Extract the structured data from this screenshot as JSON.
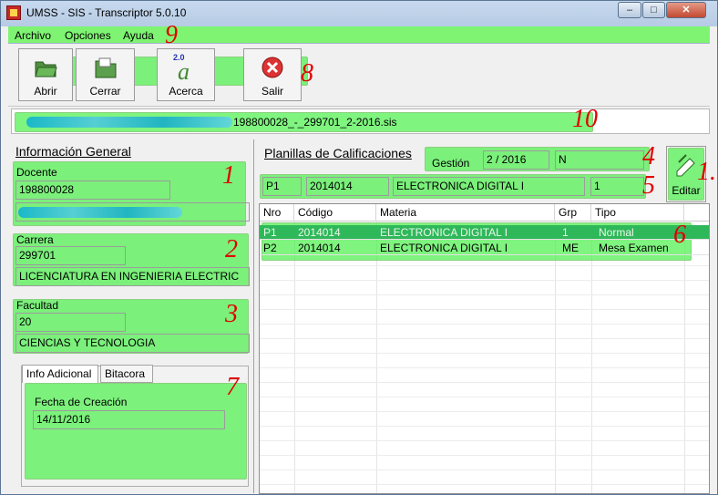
{
  "window": {
    "title": "UMSS - SIS - Transcriptor 5.0.10",
    "buttons": [
      "‒",
      "□",
      "✕"
    ]
  },
  "menu": [
    "Archivo",
    "Opciones",
    "Ayuda"
  ],
  "toolbar": {
    "open": "Abrir",
    "close": "Cerrar",
    "about": "Acerca",
    "exit": "Salir",
    "about_badge": "2.0"
  },
  "file": {
    "name": "198800028_-_299701_2-2016.sis"
  },
  "info": {
    "title": "Información General",
    "docente_label": "Docente",
    "docente_code": "198800028",
    "carrera_label": "Carrera",
    "carrera_code": "299701",
    "carrera_name": "LICENCIATURA EN INGENIERIA ELECTRIC",
    "facultad_label": "Facultad",
    "facultad_code": "20",
    "facultad_name": "CIENCIAS Y TECNOLOGIA"
  },
  "tabs": {
    "info": "Info Adicional",
    "bitacora": "Bitacora",
    "fecha_label": "Fecha de Creación",
    "fecha_value": "14/11/2016"
  },
  "planillas": {
    "title": "Planillas de Calificaciones",
    "gestion_label": "Gestión",
    "gestion_value": "2 / 2016",
    "gestion_extra": "N",
    "sel_nro": "P1",
    "sel_codigo": "2014014",
    "sel_materia": "ELECTRONICA DIGITAL I",
    "sel_grp": "1",
    "edit_label": "Editar"
  },
  "grid": {
    "headers": [
      "Nro",
      "Código",
      "Materia",
      "Grp",
      "Tipo"
    ],
    "rows": [
      [
        "P1",
        "2014014",
        "ELECTRONICA DIGITAL I",
        "1",
        "Normal"
      ],
      [
        "P2",
        "2014014",
        "ELECTRONICA DIGITAL I",
        "ME",
        "Mesa Examen"
      ]
    ]
  },
  "annotations": [
    "1",
    "2",
    "3",
    "4",
    "5",
    "6",
    "7",
    "8",
    "9",
    "10",
    "1."
  ],
  "colors": {
    "highlight": "#54f054",
    "annotation": "#e00000",
    "title_bar": "#b6cbe4"
  }
}
